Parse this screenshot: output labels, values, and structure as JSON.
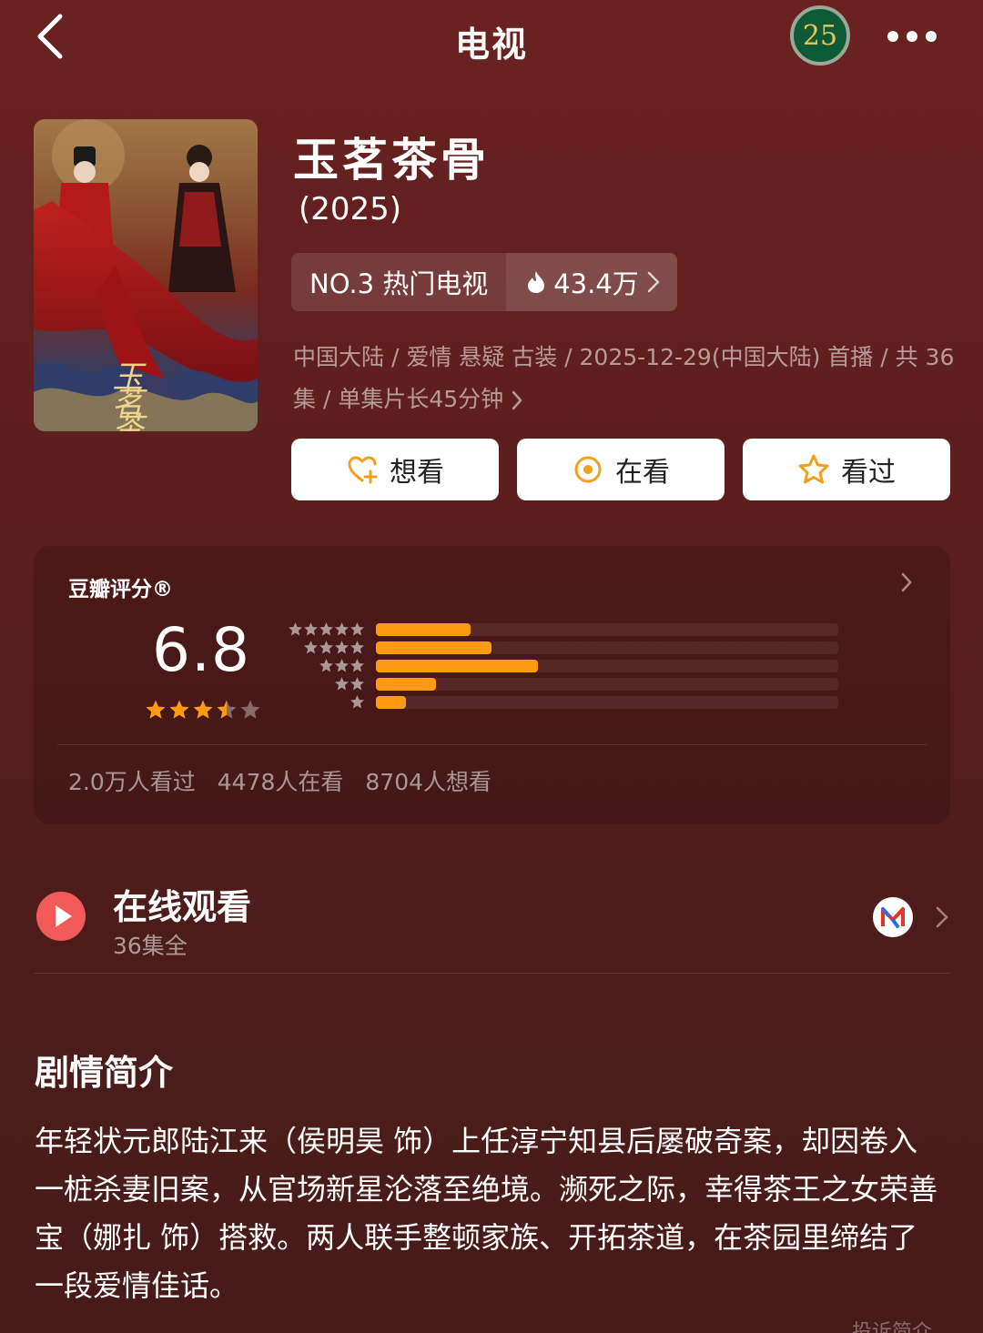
{
  "nav": {
    "title": "电视",
    "back_icon": "chevron-left-icon",
    "badge_text": "25",
    "more_icon": "more-dots-icon"
  },
  "show": {
    "title": "玉茗茶骨",
    "year": "(2025)",
    "poster_text": "玉茗茶骨",
    "rank_label": "NO.3 热门电视",
    "heat_value": "43.4万",
    "meta": "中国大陆 / 爱情 悬疑 古装 / 2025-12-29(中国大陆) 首播 / 共 36集 / 单集片长45分钟"
  },
  "actions": {
    "want": "想看",
    "watching": "在看",
    "watched": "看过"
  },
  "rating": {
    "label": "豆瓣评分®",
    "score": "6.8",
    "star_value": 3.5,
    "star_max": 5,
    "distribution": [
      {
        "stars": 5,
        "fraction": 0.205
      },
      {
        "stars": 4,
        "fraction": 0.25
      },
      {
        "stars": 3,
        "fraction": 0.35
      },
      {
        "stars": 2,
        "fraction": 0.13
      },
      {
        "stars": 1,
        "fraction": 0.065
      }
    ],
    "watched_count": "2.0万人看过",
    "watching_count": "4478人在看",
    "want_count": "8704人想看"
  },
  "online": {
    "title": "在线观看",
    "subtitle": "36集全"
  },
  "synopsis": {
    "title": "剧情简介",
    "text": "年轻状元郎陆江来（侯明昊 饰）上任淳宁知县后屡破奇案，却因卷入一桩杀妻旧案，从官场新星沦落至绝境。濒死之际，幸得茶王之女荣善宝（娜扎 饰）搭救。两人联手整顿家族、开拓茶道，在茶园里缔结了一段爱情佳话。",
    "report": "投诉简介"
  },
  "colors": {
    "background": "#5a1e1d",
    "accent_orange": "#ff9b12",
    "star_orange": "#ff9b12",
    "play_red": "#f25a5a"
  }
}
